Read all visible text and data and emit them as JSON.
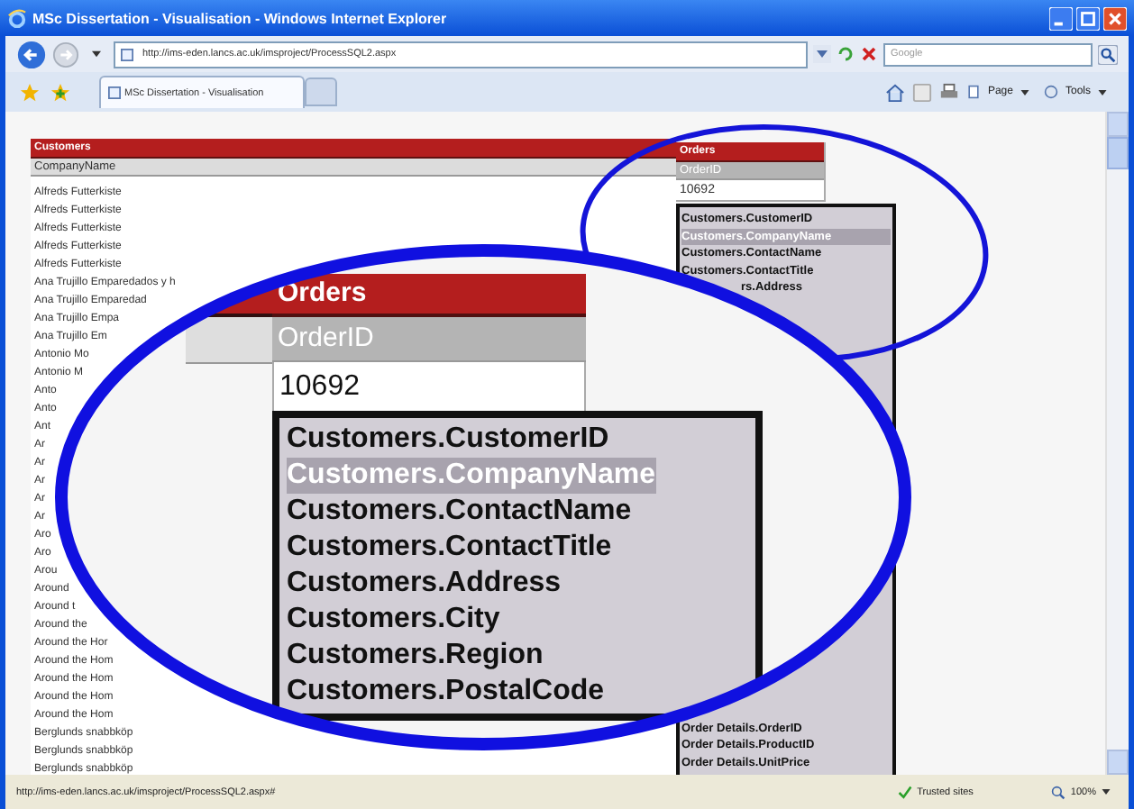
{
  "window": {
    "title": "MSc Dissertation - Visualisation - Windows Internet Explorer"
  },
  "address_bar": {
    "url": "http://ims-eden.lancs.ac.uk/imsproject/ProcessSQL2.aspx"
  },
  "search": {
    "placeholder": "Google"
  },
  "tabs": [
    {
      "label": "MSc Dissertation - Visualisation",
      "selected": true
    }
  ],
  "command_bar": [
    {
      "label": "Page"
    },
    {
      "label": "Tools"
    }
  ],
  "customers_table": {
    "title": "Customers",
    "column": "CompanyName",
    "rows": [
      "Alfreds Futterkiste",
      "Alfreds Futterkiste",
      "Alfreds Futterkiste",
      "Alfreds Futterkiste",
      "Alfreds Futterkiste",
      "Ana Trujillo Emparedados y h",
      "Ana Trujillo Emparedad",
      "Ana Trujillo Empa",
      "Ana Trujillo Em",
      "Antonio Mo",
      "Antonio M",
      "Anto",
      "Anto",
      "Ant",
      "Ar",
      "Ar",
      "Ar",
      "Ar",
      "Ar",
      "Aro",
      "Aro",
      "Arou",
      "Around",
      "Around t",
      "Around the",
      "Around the Hor",
      "Around the Hom",
      "Around the Hom",
      "Around the Hom",
      "Around the Hom",
      "Berglunds snabbköp",
      "Berglunds snabbköp",
      "Berglunds snabbköp"
    ]
  },
  "orders_table": {
    "title": "Orders",
    "column": "OrderID",
    "value": "10692"
  },
  "field_list": {
    "items": [
      {
        "label": "Customers.CustomerID",
        "selected": false
      },
      {
        "label": "Customers.CompanyName",
        "selected": true
      },
      {
        "label": "Customers.ContactName",
        "selected": false
      },
      {
        "label": "Customers.ContactTitle",
        "selected": false
      },
      {
        "label": "rs.Address",
        "selected": false,
        "kind": "cut"
      }
    ],
    "lower_items": [
      {
        "label": "Order Details.OrderID",
        "selected": false
      },
      {
        "label": "Order Details.ProductID",
        "selected": false
      },
      {
        "label": "Order Details.UnitPrice",
        "selected": false
      }
    ]
  },
  "magnified": {
    "orders_table": {
      "title": "Orders",
      "column": "OrderID",
      "value": "10692"
    },
    "field_list": {
      "items": [
        {
          "label": "Customers.CustomerID",
          "selected": false
        },
        {
          "label": "Customers.CompanyName",
          "selected": true
        },
        {
          "label": "Customers.ContactName",
          "selected": false
        },
        {
          "label": "Customers.ContactTitle",
          "selected": false
        },
        {
          "label": "Customers.Address",
          "selected": false
        },
        {
          "label": "Customers.City",
          "selected": false
        },
        {
          "label": "Customers.Region",
          "selected": false
        },
        {
          "label": "Customers.PostalCode",
          "selected": false
        }
      ]
    }
  },
  "status_bar": {
    "url": "http://ims-eden.lancs.ac.uk/imsproject/ProcessSQL2.aspx#",
    "zone": "Trusted sites",
    "zoom": "100%"
  }
}
